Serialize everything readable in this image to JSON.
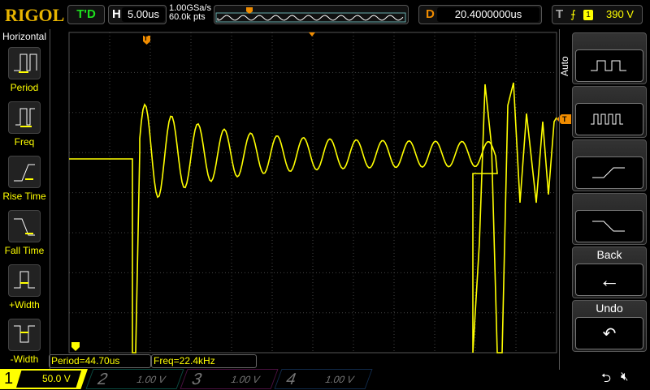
{
  "brand": "RIGOL",
  "run_status": "T'D",
  "horizontal": {
    "key": "H",
    "timebase": "5.00us",
    "sample_rate": "1.00GSa/s",
    "memory_depth": "60.0k pts"
  },
  "delay": {
    "key": "D",
    "value": "20.4000000us"
  },
  "trigger": {
    "key": "T",
    "edge": "rising",
    "source": "1",
    "level": "390 V",
    "marker": "T"
  },
  "left_menu": {
    "title": "Horizontal",
    "items": [
      {
        "label": "Period"
      },
      {
        "label": "Freq"
      },
      {
        "label": "Rise Time"
      },
      {
        "label": "Fall Time"
      },
      {
        "label": "+Width"
      },
      {
        "label": "-Width"
      }
    ]
  },
  "right_menu": {
    "mode": "Auto",
    "back": "Back",
    "undo": "Undo"
  },
  "measurements": [
    {
      "text": "Period=44.70us"
    },
    {
      "text": "Freq=22.4kHz"
    }
  ],
  "channels": [
    {
      "num": "1",
      "scale": "50.0 V",
      "color": "#ffff00",
      "active": true
    },
    {
      "num": "2",
      "scale": "1.00 V",
      "color": "#00c0a0",
      "active": false
    },
    {
      "num": "3",
      "scale": "1.00 V",
      "color": "#c000c0",
      "active": false
    },
    {
      "num": "4",
      "scale": "1.00 V",
      "color": "#2070ff",
      "active": false
    }
  ],
  "colors": {
    "trace": "#ffff00",
    "accent": "#f08c00"
  }
}
